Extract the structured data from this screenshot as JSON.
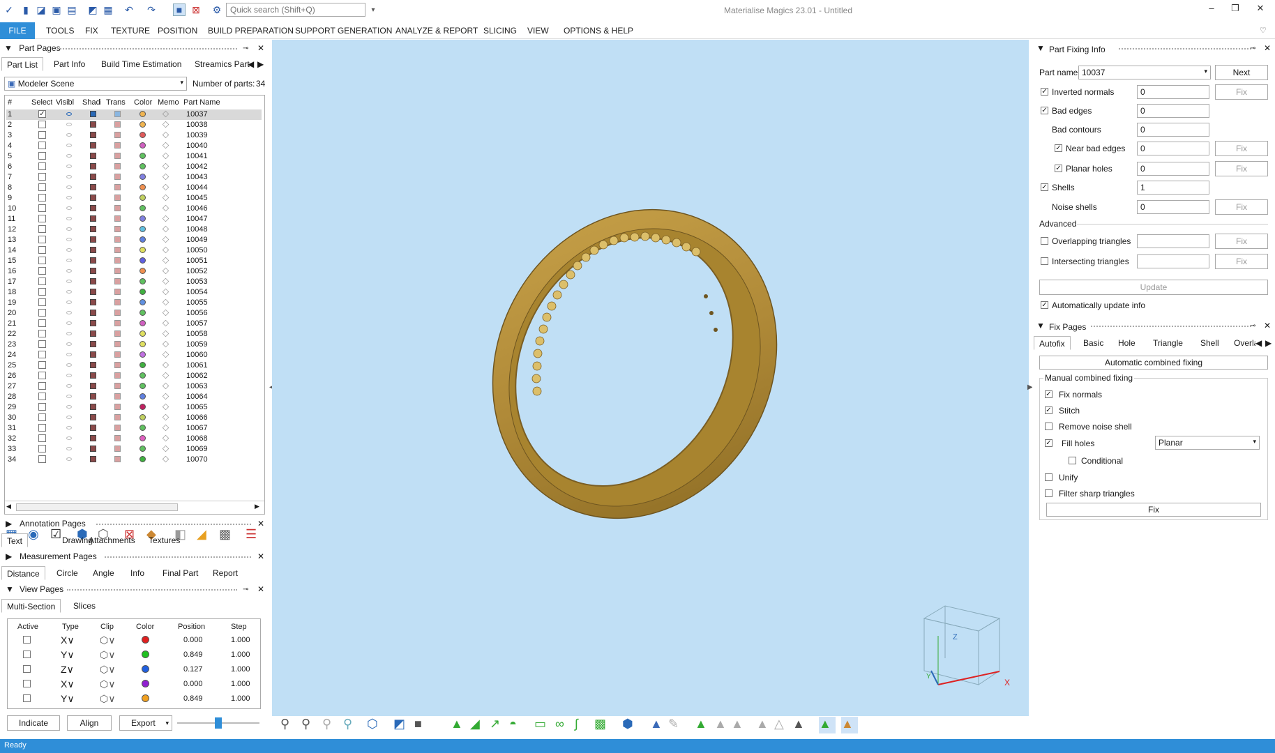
{
  "app": {
    "title": "Materialise Magics 23.01 - Untitled",
    "search_placeholder": "Quick search (Shift+Q)",
    "status": "Ready"
  },
  "menu": [
    "FILE",
    "TOOLS",
    "FIX",
    "TEXTURE",
    "POSITION",
    "BUILD PREPARATION",
    "SUPPORT GENERATION",
    "ANALYZE & REPORT",
    "SLICING",
    "VIEW",
    "OPTIONS & HELP"
  ],
  "part_pages": {
    "title": "Part Pages",
    "tabs": [
      "Part List",
      "Part Info",
      "Build Time Estimation",
      "Streamics Part"
    ],
    "scene": "Modeler Scene",
    "num_parts_label": "Number of parts:",
    "num_parts": "34",
    "columns": [
      "#",
      "Select",
      "Visibl",
      "Shadi",
      "Trans",
      "Color",
      "Memo",
      "Part Name"
    ],
    "rows": [
      {
        "n": "1",
        "name": "10037",
        "color": "#f0b450",
        "selected": true
      },
      {
        "n": "2",
        "name": "10038",
        "color": "#f0b450"
      },
      {
        "n": "3",
        "name": "10039",
        "color": "#e05a5a"
      },
      {
        "n": "4",
        "name": "10040",
        "color": "#d060c0"
      },
      {
        "n": "5",
        "name": "10041",
        "color": "#60c060"
      },
      {
        "n": "6",
        "name": "10042",
        "color": "#60c060"
      },
      {
        "n": "7",
        "name": "10043",
        "color": "#8080e0"
      },
      {
        "n": "8",
        "name": "10044",
        "color": "#f09050"
      },
      {
        "n": "9",
        "name": "10045",
        "color": "#c0d060"
      },
      {
        "n": "10",
        "name": "10046",
        "color": "#60c060"
      },
      {
        "n": "11",
        "name": "10047",
        "color": "#8080e0"
      },
      {
        "n": "12",
        "name": "10048",
        "color": "#60c0e0"
      },
      {
        "n": "13",
        "name": "10049",
        "color": "#6080e0"
      },
      {
        "n": "14",
        "name": "10050",
        "color": "#e0e060"
      },
      {
        "n": "15",
        "name": "10051",
        "color": "#6060e0"
      },
      {
        "n": "16",
        "name": "10052",
        "color": "#f09050"
      },
      {
        "n": "17",
        "name": "10053",
        "color": "#60c060"
      },
      {
        "n": "18",
        "name": "10054",
        "color": "#40b040"
      },
      {
        "n": "19",
        "name": "10055",
        "color": "#6090e0"
      },
      {
        "n": "20",
        "name": "10056",
        "color": "#60c060"
      },
      {
        "n": "21",
        "name": "10057",
        "color": "#d060c0"
      },
      {
        "n": "22",
        "name": "10058",
        "color": "#e0e060"
      },
      {
        "n": "23",
        "name": "10059",
        "color": "#e0e060"
      },
      {
        "n": "24",
        "name": "10060",
        "color": "#c070e0"
      },
      {
        "n": "25",
        "name": "10061",
        "color": "#40b040"
      },
      {
        "n": "26",
        "name": "10062",
        "color": "#60c060"
      },
      {
        "n": "27",
        "name": "10063",
        "color": "#60c060"
      },
      {
        "n": "28",
        "name": "10064",
        "color": "#6080e0"
      },
      {
        "n": "29",
        "name": "10065",
        "color": "#c02060"
      },
      {
        "n": "30",
        "name": "10066",
        "color": "#c0d060"
      },
      {
        "n": "31",
        "name": "10067",
        "color": "#60c060"
      },
      {
        "n": "32",
        "name": "10068",
        "color": "#e060c0"
      },
      {
        "n": "33",
        "name": "10069",
        "color": "#60c060"
      },
      {
        "n": "34",
        "name": "10070",
        "color": "#40b040"
      }
    ]
  },
  "annotation_pages": {
    "title": "Annotation Pages",
    "tabs": [
      "Text",
      "Drawing",
      "Attachments",
      "Textures"
    ]
  },
  "measurement_pages": {
    "title": "Measurement Pages",
    "tabs": [
      "Distance",
      "Circle",
      "Angle",
      "Info",
      "Final Part",
      "Report"
    ]
  },
  "view_pages": {
    "title": "View Pages",
    "tabs": [
      "Multi-Section",
      "Slices"
    ],
    "columns": [
      "Active",
      "Type",
      "Clip",
      "Color",
      "Position",
      "Step"
    ],
    "rows": [
      {
        "type": "X",
        "color": "#e02020",
        "position": "0.000",
        "step": "1.000"
      },
      {
        "type": "Y",
        "color": "#20c020",
        "position": "0.849",
        "step": "1.000"
      },
      {
        "type": "Z",
        "color": "#2060e0",
        "position": "0.127",
        "step": "1.000"
      },
      {
        "type": "X",
        "color": "#9020d0",
        "position": "0.000",
        "step": "1.000"
      },
      {
        "type": "Y",
        "color": "#f0a020",
        "position": "0.849",
        "step": "1.000"
      }
    ],
    "buttons": {
      "indicate": "Indicate",
      "align": "Align",
      "export": "Export"
    }
  },
  "part_fixing_info": {
    "title": "Part Fixing Info",
    "part_name_label": "Part name",
    "part_name": "10037",
    "next": "Next",
    "fix": "Fix",
    "rows": {
      "inverted_normals": {
        "label": "Inverted normals",
        "value": "0"
      },
      "bad_edges": {
        "label": "Bad edges",
        "value": "0"
      },
      "bad_contours": {
        "label": "Bad contours",
        "value": "0"
      },
      "near_bad_edges": {
        "label": "Near bad edges",
        "value": "0"
      },
      "planar_holes": {
        "label": "Planar holes",
        "value": "0"
      },
      "shells": {
        "label": "Shells",
        "value": "1"
      },
      "noise_shells": {
        "label": "Noise shells",
        "value": "0"
      },
      "overlapping": {
        "label": "Overlapping triangles",
        "value": ""
      },
      "intersecting": {
        "label": "Intersecting triangles",
        "value": ""
      }
    },
    "advanced": "Advanced",
    "update": "Update",
    "auto_update": "Automatically update info"
  },
  "fix_pages": {
    "title": "Fix Pages",
    "tabs": [
      "Autofix",
      "Basic",
      "Hole",
      "Triangle",
      "Shell",
      "Overla"
    ],
    "auto_combined": "Automatic combined fixing",
    "manual_title": "Manual combined fixing",
    "fix_normals": "Fix normals",
    "stitch": "Stitch",
    "remove_noise": "Remove noise shell",
    "fill_holes": "Fill holes",
    "fill_mode": "Planar",
    "conditional": "Conditional",
    "unify": "Unify",
    "filter_sharp": "Filter sharp triangles",
    "fix": "Fix"
  },
  "axes": {
    "x": "X",
    "y": "Y",
    "z": "Z"
  }
}
